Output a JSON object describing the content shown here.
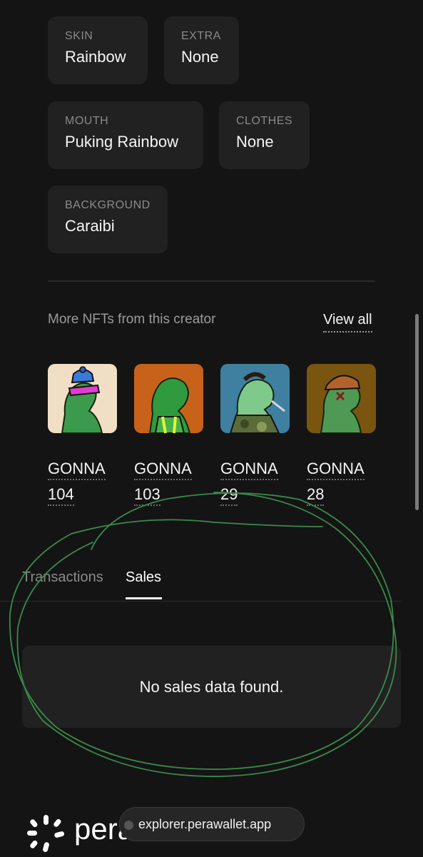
{
  "traits": [
    {
      "label": "SKIN",
      "value": "Rainbow"
    },
    {
      "label": "EXTRA",
      "value": "None"
    },
    {
      "label": "MOUTH",
      "value": "Puking Rainbow"
    },
    {
      "label": "CLOTHES",
      "value": "None"
    },
    {
      "label": "BACKGROUND",
      "value": "Caraibi"
    }
  ],
  "more_nfts": {
    "title": "More NFTs from this creator",
    "view_all": "View all",
    "items": [
      {
        "line1": "GONNA",
        "line2": "104",
        "bg": "#f0dfc4"
      },
      {
        "line1": "GONNA",
        "line2": "103",
        "bg": "#c8621a"
      },
      {
        "line1": "GONNA",
        "line2": "29",
        "bg": "#3f7fa0"
      },
      {
        "line1": "GONNA",
        "line2": "28",
        "bg": "#7a5510"
      }
    ]
  },
  "tabs": {
    "transactions": "Transactions",
    "sales": "Sales",
    "active": "Sales"
  },
  "sales": {
    "empty_message": "No sales data found."
  },
  "footer": {
    "brand": "pera",
    "url": "explorer.perawallet.app"
  },
  "colors": {
    "background": "#141414",
    "card": "#212121",
    "annotation": "#3a8a4a"
  }
}
